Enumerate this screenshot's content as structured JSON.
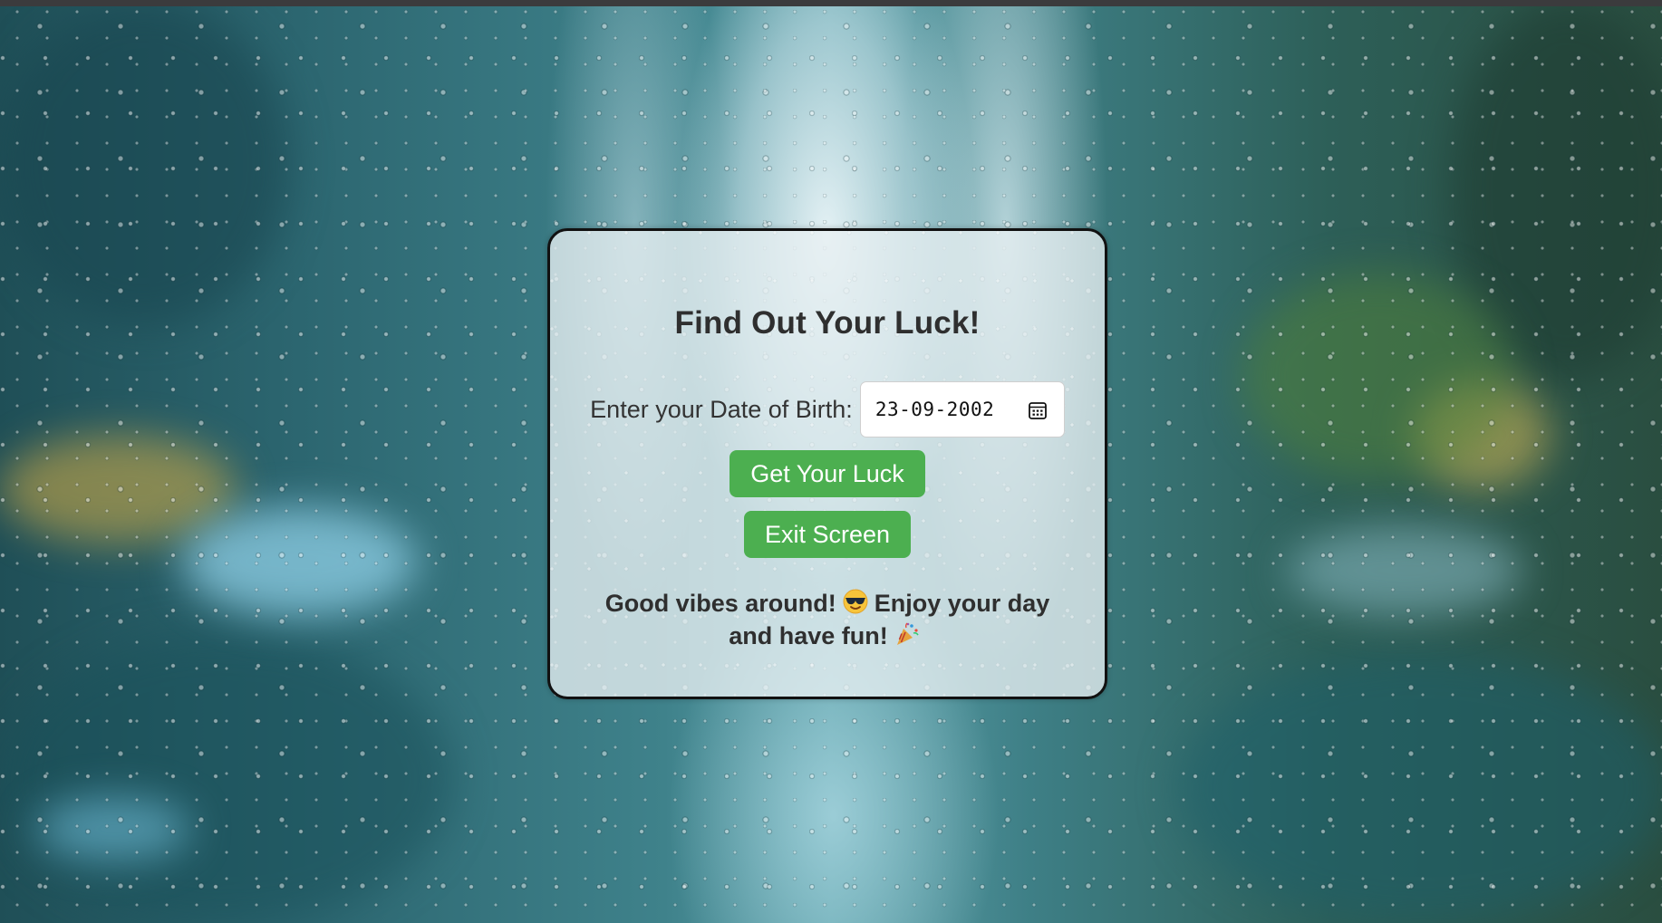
{
  "page": {
    "title": "Find Out Your Luck!"
  },
  "form": {
    "dob_label": "Enter your Date of Birth:",
    "dob_value": "23-09-2002"
  },
  "buttons": {
    "get_luck": "Get Your Luck",
    "exit_screen": "Exit Screen"
  },
  "result": {
    "part1": "Good vibes around!",
    "emoji1": "smiling-face-with-sunglasses",
    "part2": "Enjoy your day and have fun!",
    "emoji2": "party-popper"
  },
  "icons": {
    "date_picker": "calendar-icon"
  },
  "colors": {
    "button_bg": "#4caf50",
    "button_text": "#ffffff",
    "card_border": "#111111",
    "heading_text": "#2f2f2f"
  }
}
